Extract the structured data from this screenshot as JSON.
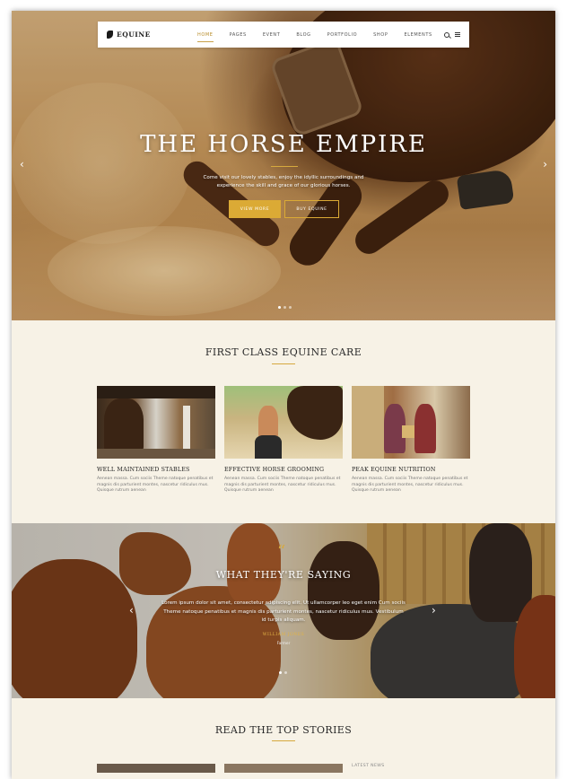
{
  "brand": {
    "name": "EQUINE"
  },
  "nav": {
    "items": [
      "HOME",
      "PAGES",
      "EVENT",
      "BLOG",
      "PORTFOLIO",
      "SHOP",
      "ELEMENTS"
    ],
    "active_index": 0
  },
  "hero": {
    "title": "THE HORSE EMPIRE",
    "text": "Come visit our lovely stables, enjoy the idyllic surroundings and experience the skill and grace of our glorious horses.",
    "primary_button": "VIEW MORE",
    "secondary_button": "BUY EQUINE",
    "slides_count": 3,
    "active_slide": 0
  },
  "services": {
    "title": "FIRST CLASS EQUINE CARE",
    "cards": [
      {
        "title": "WELL MAINTAINED STABLES",
        "text": "Aenean massa. Cum sociis Theme natoque penatibus et magnis dis parturient montes, nascetur ridiculus mus. Quisque rutrum aenean"
      },
      {
        "title": "EFFECTIVE HORSE GROOMING",
        "text": "Aenean massa. Cum sociis Theme natoque penatibus et magnis dis parturient montes, nascetur ridiculus mus. Quisque rutrum aenean"
      },
      {
        "title": "PEAK EQUINE NUTRITION",
        "text": "Aenean massa. Cum sociis Theme natoque penatibus et magnis dis parturient montes, nascetur ridiculus mus. Quisque rutrum aenean"
      }
    ]
  },
  "testimonial": {
    "quote_glyph": "“",
    "title": "WHAT THEY'RE SAYING",
    "text": "Lorem ipsum dolor sit amet, consectetur adipiscing elit. Ut ullamcorper leo eget enim Cum sociis Theme natoque penatibus et magnis dis parturient montes, nascetur ridiculus mus. Vestibulum id turpis aliquam.",
    "name": "WILLIAM JONES",
    "role": "Farmer",
    "slides_count": 2,
    "active_slide": 0
  },
  "stories": {
    "title": "READ THE TOP STORIES",
    "side_label": "LATEST NEWS"
  },
  "icons": {
    "search": "search-icon",
    "menu": "hamburger-menu-icon",
    "prev": "chevron-left-icon",
    "next": "chevron-right-icon"
  },
  "colors": {
    "accent": "#dbaa35",
    "background": "#f7f2e6",
    "heading": "#2a2a2a"
  }
}
